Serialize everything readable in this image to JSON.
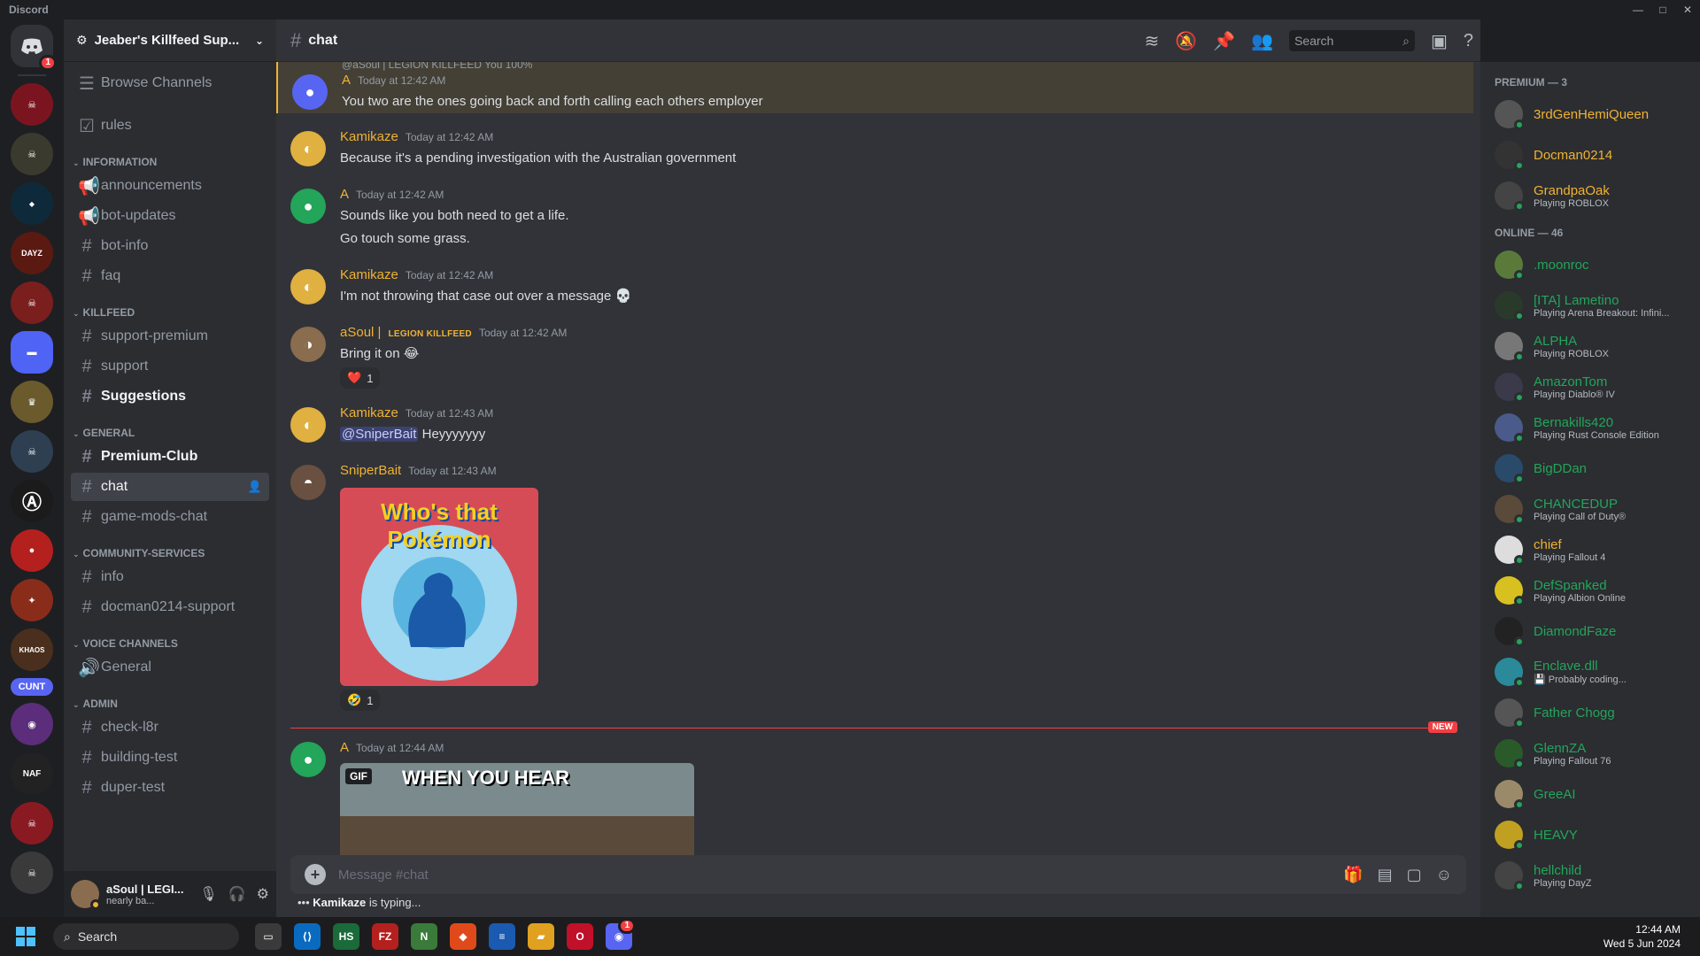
{
  "window": {
    "title": "Discord",
    "controls": [
      "—",
      "□",
      "✕"
    ]
  },
  "guilds": {
    "home_badge": "1",
    "cunt_label": "CUNT",
    "colors": [
      "#7a1520",
      "#3b3a2e",
      "#0e2a3a",
      "#5a1a12",
      "#7a1e1e",
      "#4f63f5",
      "#6b5a2c",
      "#2f3f52",
      "#1b1b1b",
      "#b3201e",
      "#8a2c1a",
      "#4a2f1e",
      "#5865f2",
      "#5b2d7a",
      "#222",
      "#8a1a22",
      "#3a3a3a"
    ]
  },
  "server": {
    "name": "Jeaber's Killfeed Sup...",
    "browse": "Browse Channels"
  },
  "channels": {
    "rules": "rules",
    "cat_information": "INFORMATION",
    "announcements": "announcements",
    "bot_updates": "bot-updates",
    "bot_info": "bot-info",
    "faq": "faq",
    "cat_killfeed": "KILLFEED",
    "support_premium": "support-premium",
    "support": "support",
    "suggestions": "Suggestions",
    "cat_general": "GENERAL",
    "premium_club": "Premium-Club",
    "chat": "chat",
    "game_mods": "game-mods-chat",
    "cat_community": "COMMUNITY-SERVICES",
    "info": "info",
    "docman": "docman0214-support",
    "cat_voice": "VOICE CHANNELS",
    "general_voice": "General",
    "cat_admin": "ADMIN",
    "check": "check-l8r",
    "building": "building-test",
    "duper": "duper-test"
  },
  "user": {
    "name": "aSoul | LEGI...",
    "status": "nearly ba..."
  },
  "header": {
    "channel": "chat",
    "search_placeholder": "Search"
  },
  "messages": [
    {
      "reply": "@aSoul | LEGION KILLFEED  You 100%",
      "author": "A",
      "time": "Today at 12:42 AM",
      "lines": [
        "You two are the ones going back and forth calling each others employer"
      ]
    },
    {
      "author": "Kamikaze",
      "time": "Today at 12:42 AM",
      "lines": [
        "Because it's a pending investigation with the Australian government"
      ]
    },
    {
      "author": "A",
      "time": "Today at 12:42 AM",
      "lines": [
        "Sounds like you both need to get a life.",
        "Go touch some grass."
      ]
    },
    {
      "author": "Kamikaze",
      "time": "Today at 12:42 AM",
      "lines": [
        "I'm not throwing that case out over a message 💀"
      ]
    },
    {
      "author": "aSoul |",
      "tag": "LEGION KILLFEED",
      "time": "Today at 12:42 AM",
      "lines": [
        "Bring it on 😂"
      ],
      "reaction": "❤️",
      "reaction_count": "1"
    },
    {
      "author": "Kamikaze",
      "time": "Today at 12:43 AM",
      "mention": "@SniperBait",
      "lines": [
        "Heyyyyyyy"
      ]
    },
    {
      "author": "SniperBait",
      "time": "Today at 12:43 AM",
      "image_text": "Who's that Pokémon",
      "reaction": "🤣",
      "reaction_count": "1"
    },
    {
      "author": "A",
      "time": "Today at 12:44 AM",
      "gif_label": "GIF",
      "gif_caption": "WHEN YOU HEAR"
    }
  ],
  "new_label": "NEW",
  "composer": {
    "placeholder": "Message #chat",
    "typing_user": "Kamikaze",
    "typing_text": "is typing..."
  },
  "members": {
    "premium_header": "PREMIUM — 3",
    "premium": [
      {
        "name": "3rdGenHemiQueen",
        "activity": "",
        "color": "#f0b232",
        "av": "#555"
      },
      {
        "name": "Docman0214",
        "activity": "",
        "color": "#f0b232",
        "av": "#333"
      },
      {
        "name": "GrandpaOak",
        "activity": "Playing ROBLOX",
        "color": "#f0b232",
        "av": "#444"
      }
    ],
    "online_header": "ONLINE — 46",
    "online": [
      {
        "name": ".moonroc",
        "activity": "",
        "av": "#5a7a3a"
      },
      {
        "name": "[ITA] Lametino",
        "activity": "Playing Arena Breakout: Infini...",
        "av": "#2a3a2a"
      },
      {
        "name": "ALPHA",
        "activity": "Playing ROBLOX",
        "av": "#777"
      },
      {
        "name": "AmazonTom",
        "activity": "Playing Diablo® IV",
        "av": "#3a3a4a"
      },
      {
        "name": "Bernakills420",
        "activity": "Playing Rust Console Edition",
        "av": "#4a5a8a"
      },
      {
        "name": "BigDDan",
        "activity": "",
        "av": "#2a4a6a"
      },
      {
        "name": "CHANCEDUP",
        "activity": "Playing Call of Duty®",
        "av": "#5a4a3a"
      },
      {
        "name": "chief",
        "activity": "Playing Fallout 4",
        "color": "#f0b232",
        "av": "#ddd"
      },
      {
        "name": "DefSpanked",
        "activity": "Playing Albion Online",
        "av": "#d8c020"
      },
      {
        "name": "DiamondFaze",
        "activity": "",
        "av": "#222"
      },
      {
        "name": "Enclave.dll",
        "activity": "💾 Probably coding...",
        "av": "#2a8a9a"
      },
      {
        "name": "Father Chogg",
        "activity": "",
        "av": "#555"
      },
      {
        "name": "GlennZA",
        "activity": "Playing Fallout 76",
        "av": "#2a5a2a"
      },
      {
        "name": "GreeAI",
        "activity": "",
        "av": "#9a8a6a"
      },
      {
        "name": "HEAVY",
        "activity": "",
        "av": "#c0a020"
      },
      {
        "name": "hellchild",
        "activity": "Playing DayZ",
        "av": "#444"
      }
    ]
  },
  "taskbar": {
    "search": "Search",
    "time": "12:44 AM",
    "date": "Wed 5 Jun 2024",
    "discord_badge": "1"
  },
  "colors": {
    "accent": "#5865f2",
    "kamikaze": "#f0b232",
    "asoul": "#f0b232",
    "sniper": "#f0b232",
    "a": "#f0b232",
    "online_name": "#23a55a"
  }
}
